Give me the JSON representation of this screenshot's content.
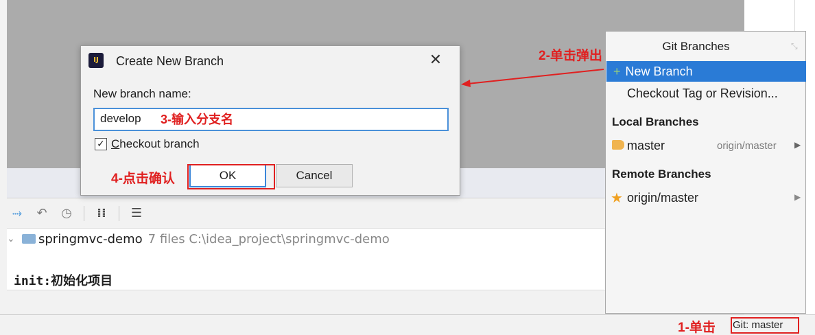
{
  "colors": {
    "annotation_red": "#e02020",
    "selection_blue": "#2a7bd6",
    "focus_blue": "#4a90d9",
    "editor_grey": "#ababab"
  },
  "dialog": {
    "title": "Create New Branch",
    "close_glyph": "✕",
    "icon": "intellij-idea-icon",
    "branch_name_label": "New branch name:",
    "branch_name_value": "develop",
    "checkout_checked": true,
    "checkout_label": "Checkout branch",
    "ok_label": "OK",
    "cancel_label": "Cancel"
  },
  "git_branches": {
    "title": "Git Branches",
    "new_branch_label": "New Branch",
    "checkout_tag_label": "Checkout Tag or Revision...",
    "local_header": "Local Branches",
    "local_branch": "master",
    "local_branch_tracking": "origin/master",
    "remote_header": "Remote Branches",
    "remote_branch": "origin/master"
  },
  "toolbar": {
    "icons": [
      "cherry-pick-icon",
      "revert-icon",
      "history-icon",
      "expand-icon",
      "collapse-icon"
    ]
  },
  "changes_tree": {
    "project_name": "springmvc-demo",
    "project_meta": "7 files  C:\\idea_project\\springmvc-demo"
  },
  "commit": {
    "message": "init:初始化项目"
  },
  "status_bar": {
    "git_widget": "Git: master"
  },
  "annotations": {
    "step1": "1-单击",
    "step2": "2-单击弹出",
    "step3": "3-输入分支名",
    "step4": "4-点击确认"
  }
}
